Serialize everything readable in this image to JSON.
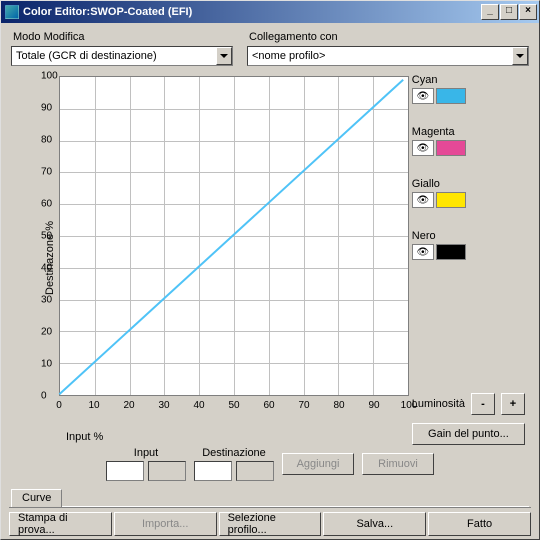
{
  "title": "Color Editor:SWOP-Coated (EFI)",
  "fields": {
    "mode_label": "Modo Modifica",
    "mode_value": "Totale (GCR di destinazione)",
    "link_label": "Collegamento con",
    "link_value": "<nome profilo>"
  },
  "axes": {
    "ylabel": "Destinazone %",
    "xlabel": "Input %",
    "x_ticks": [
      "0",
      "10",
      "20",
      "30",
      "40",
      "50",
      "60",
      "70",
      "80",
      "90",
      "100"
    ],
    "y_ticks": [
      "0",
      "10",
      "20",
      "30",
      "40",
      "50",
      "60",
      "70",
      "80",
      "90",
      "100"
    ]
  },
  "colors": {
    "cyan": {
      "label": "Cyan",
      "hex": "#39b6e8"
    },
    "magenta": {
      "label": "Magenta",
      "hex": "#e54997"
    },
    "giallo": {
      "label": "Giallo",
      "hex": "#ffe600"
    },
    "nero": {
      "label": "Nero",
      "hex": "#000000"
    }
  },
  "luminosity": {
    "label": "Luminosità",
    "minus": "-",
    "plus": "+"
  },
  "gain_button": "Gain del punto...",
  "input_labels": {
    "input": "Input",
    "dest": "Destinazione"
  },
  "actions": {
    "add": "Aggiungi",
    "remove": "Rimuovi"
  },
  "tab": "Curve",
  "bottom": {
    "proof": "Stampa di prova...",
    "import": "Importa...",
    "select": "Selezione profilo...",
    "save": "Salva...",
    "done": "Fatto"
  },
  "chart_data": {
    "type": "line",
    "title": "",
    "xlabel": "Input %",
    "ylabel": "Destinazone %",
    "xlim": [
      0,
      100
    ],
    "ylim": [
      0,
      100
    ],
    "x": [
      0,
      100
    ],
    "y": [
      0,
      100
    ]
  }
}
